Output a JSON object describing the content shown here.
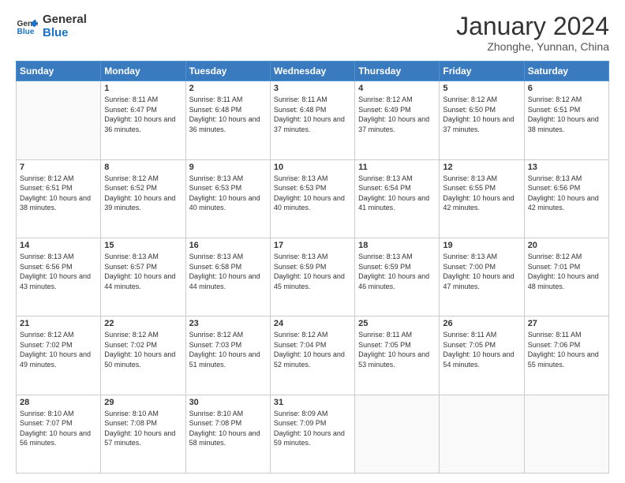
{
  "logo": {
    "line1": "General",
    "line2": "Blue"
  },
  "header": {
    "month": "January 2024",
    "location": "Zhonghe, Yunnan, China"
  },
  "days_of_week": [
    "Sunday",
    "Monday",
    "Tuesday",
    "Wednesday",
    "Thursday",
    "Friday",
    "Saturday"
  ],
  "weeks": [
    [
      {
        "num": "",
        "empty": true
      },
      {
        "num": "1",
        "sunrise": "8:11 AM",
        "sunset": "6:47 PM",
        "daylight": "10 hours and 36 minutes."
      },
      {
        "num": "2",
        "sunrise": "8:11 AM",
        "sunset": "6:48 PM",
        "daylight": "10 hours and 36 minutes."
      },
      {
        "num": "3",
        "sunrise": "8:11 AM",
        "sunset": "6:48 PM",
        "daylight": "10 hours and 37 minutes."
      },
      {
        "num": "4",
        "sunrise": "8:12 AM",
        "sunset": "6:49 PM",
        "daylight": "10 hours and 37 minutes."
      },
      {
        "num": "5",
        "sunrise": "8:12 AM",
        "sunset": "6:50 PM",
        "daylight": "10 hours and 37 minutes."
      },
      {
        "num": "6",
        "sunrise": "8:12 AM",
        "sunset": "6:51 PM",
        "daylight": "10 hours and 38 minutes."
      }
    ],
    [
      {
        "num": "7",
        "sunrise": "8:12 AM",
        "sunset": "6:51 PM",
        "daylight": "10 hours and 38 minutes."
      },
      {
        "num": "8",
        "sunrise": "8:12 AM",
        "sunset": "6:52 PM",
        "daylight": "10 hours and 39 minutes."
      },
      {
        "num": "9",
        "sunrise": "8:13 AM",
        "sunset": "6:53 PM",
        "daylight": "10 hours and 40 minutes."
      },
      {
        "num": "10",
        "sunrise": "8:13 AM",
        "sunset": "6:53 PM",
        "daylight": "10 hours and 40 minutes."
      },
      {
        "num": "11",
        "sunrise": "8:13 AM",
        "sunset": "6:54 PM",
        "daylight": "10 hours and 41 minutes."
      },
      {
        "num": "12",
        "sunrise": "8:13 AM",
        "sunset": "6:55 PM",
        "daylight": "10 hours and 42 minutes."
      },
      {
        "num": "13",
        "sunrise": "8:13 AM",
        "sunset": "6:56 PM",
        "daylight": "10 hours and 42 minutes."
      }
    ],
    [
      {
        "num": "14",
        "sunrise": "8:13 AM",
        "sunset": "6:56 PM",
        "daylight": "10 hours and 43 minutes."
      },
      {
        "num": "15",
        "sunrise": "8:13 AM",
        "sunset": "6:57 PM",
        "daylight": "10 hours and 44 minutes."
      },
      {
        "num": "16",
        "sunrise": "8:13 AM",
        "sunset": "6:58 PM",
        "daylight": "10 hours and 44 minutes."
      },
      {
        "num": "17",
        "sunrise": "8:13 AM",
        "sunset": "6:59 PM",
        "daylight": "10 hours and 45 minutes."
      },
      {
        "num": "18",
        "sunrise": "8:13 AM",
        "sunset": "6:59 PM",
        "daylight": "10 hours and 46 minutes."
      },
      {
        "num": "19",
        "sunrise": "8:13 AM",
        "sunset": "7:00 PM",
        "daylight": "10 hours and 47 minutes."
      },
      {
        "num": "20",
        "sunrise": "8:12 AM",
        "sunset": "7:01 PM",
        "daylight": "10 hours and 48 minutes."
      }
    ],
    [
      {
        "num": "21",
        "sunrise": "8:12 AM",
        "sunset": "7:02 PM",
        "daylight": "10 hours and 49 minutes."
      },
      {
        "num": "22",
        "sunrise": "8:12 AM",
        "sunset": "7:02 PM",
        "daylight": "10 hours and 50 minutes."
      },
      {
        "num": "23",
        "sunrise": "8:12 AM",
        "sunset": "7:03 PM",
        "daylight": "10 hours and 51 minutes."
      },
      {
        "num": "24",
        "sunrise": "8:12 AM",
        "sunset": "7:04 PM",
        "daylight": "10 hours and 52 minutes."
      },
      {
        "num": "25",
        "sunrise": "8:11 AM",
        "sunset": "7:05 PM",
        "daylight": "10 hours and 53 minutes."
      },
      {
        "num": "26",
        "sunrise": "8:11 AM",
        "sunset": "7:05 PM",
        "daylight": "10 hours and 54 minutes."
      },
      {
        "num": "27",
        "sunrise": "8:11 AM",
        "sunset": "7:06 PM",
        "daylight": "10 hours and 55 minutes."
      }
    ],
    [
      {
        "num": "28",
        "sunrise": "8:10 AM",
        "sunset": "7:07 PM",
        "daylight": "10 hours and 56 minutes."
      },
      {
        "num": "29",
        "sunrise": "8:10 AM",
        "sunset": "7:08 PM",
        "daylight": "10 hours and 57 minutes."
      },
      {
        "num": "30",
        "sunrise": "8:10 AM",
        "sunset": "7:08 PM",
        "daylight": "10 hours and 58 minutes."
      },
      {
        "num": "31",
        "sunrise": "8:09 AM",
        "sunset": "7:09 PM",
        "daylight": "10 hours and 59 minutes."
      },
      {
        "num": "",
        "empty": true
      },
      {
        "num": "",
        "empty": true
      },
      {
        "num": "",
        "empty": true
      }
    ]
  ],
  "labels": {
    "sunrise": "Sunrise:",
    "sunset": "Sunset:",
    "daylight": "Daylight:"
  }
}
